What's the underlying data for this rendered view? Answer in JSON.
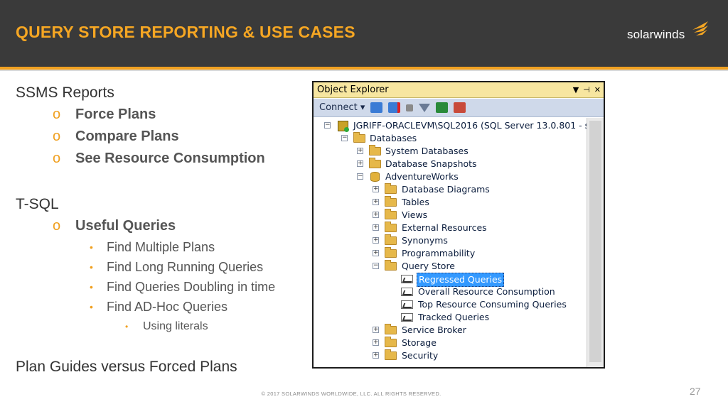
{
  "header": {
    "title": "QUERY STORE REPORTING & USE CASES",
    "logo_text": "solarwinds",
    "colors": {
      "background": "#3a3a3a",
      "accent": "#f5a623"
    }
  },
  "bullets": {
    "ssms": {
      "heading": "SSMS Reports",
      "items": [
        "Force Plans",
        "Compare Plans",
        "See Resource Consumption"
      ]
    },
    "tsql": {
      "heading": "T-SQL",
      "sub_heading": "Useful Queries",
      "items": [
        "Find Multiple Plans",
        "Find Long Running Queries",
        "Find Queries Doubling in time",
        "Find AD-Hoc Queries"
      ],
      "nested_item": "Using literals"
    },
    "plan_guides": "Plan Guides versus Forced Plans",
    "level2_marker": "o",
    "level3_marker": "•"
  },
  "object_explorer": {
    "title": "Object Explorer",
    "title_buttons": [
      "▼",
      "⊣",
      "✕"
    ],
    "toolbar": {
      "connect_label": "Connect ▾"
    },
    "tree": {
      "server": "JGRIFF-ORACLEVM\\SQL2016 (SQL Server 13.0.801 - s",
      "databases": "Databases",
      "system_databases": "System Databases",
      "database_snapshots": "Database Snapshots",
      "adventureworks": "AdventureWorks",
      "aw_children": [
        "Database Diagrams",
        "Tables",
        "Views",
        "External Resources",
        "Synonyms",
        "Programmability"
      ],
      "query_store": "Query Store",
      "reports": [
        "Regressed Queries",
        "Overall Resource Consumption",
        "Top Resource Consuming Queries",
        "Tracked Queries"
      ],
      "selected_report": "Regressed Queries",
      "after_items": [
        "Service Broker",
        "Storage",
        "Security"
      ],
      "expand_plus": "+",
      "expand_minus": "−"
    }
  },
  "footer": {
    "copyright": "© 2017 SOLARWINDS WORLDWIDE, LLC. ALL RIGHTS RESERVED.",
    "page_number": "27"
  }
}
